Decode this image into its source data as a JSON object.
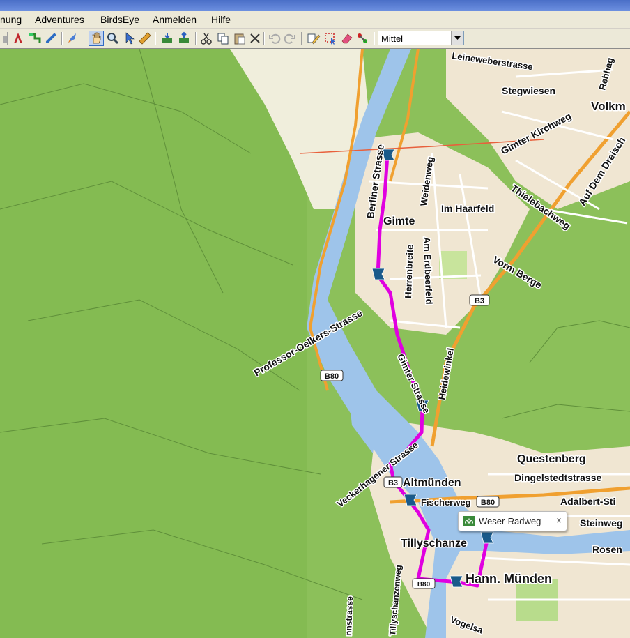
{
  "menu": {
    "items": [
      "nung",
      "Adventures",
      "BirdsEye",
      "Anmelden",
      "Hilfe"
    ]
  },
  "toolbar": {
    "zoom_value": "Mittel"
  },
  "map": {
    "places": {
      "gimte": "Gimte",
      "altmuenden": "Altmünden",
      "questenberg": "Questenberg",
      "tillyschanze": "Tillyschanze",
      "hann_muenden": "Hann. Münden",
      "volkm": "Volkm",
      "stegwiesen": "Stegwiesen",
      "im_haarfeld": "Im Haarfeld"
    },
    "streets": {
      "leineweberstrasse": "Leineweberstrasse",
      "rehhag": "Rehhag",
      "gimter_kirchweg": "Gimter Kirchweg",
      "auf_dem_dreisch": "Auf Dem Dreisch",
      "thielebachweg": "Thielebachweg",
      "weidenweg": "Weidenweg",
      "berliner_strasse": "Berliner Strasse",
      "herrenbreite": "Herrenbreite",
      "am_erdbeerfeld": "Am Erdbeerfeld",
      "vorm_berge": "Vorm Berge",
      "professor_oelkers_strasse": "Professor-Oelkers-Strasse",
      "heidewinkel": "Heidewinkel",
      "gimter_strasse": "Gimter Strasse",
      "veckerhagener_strasse": "Veckerhagener Strasse",
      "dingelstedtstrasse": "Dingelstedtstrasse",
      "adalbert_stifter": "Adalbert-Sti",
      "steinweg": "Steinweg",
      "rosen": "Rosen",
      "fischerweg": "Fischerweg",
      "tillyschanzenweg": "Tillyschanzenweg",
      "vogelsang": "Vogelsa",
      "kronstrasse": "nnstrasse"
    },
    "shields": {
      "b3": "B3",
      "b80_west": "B80",
      "b80_east": "B80",
      "b3_south": "B3",
      "b80_south": "B80"
    }
  },
  "popup": {
    "label": "Weser-Radweg",
    "close": "×"
  },
  "colors": {
    "forest": "#8cc05a",
    "river": "#9ec4ea",
    "route": "#e000e0",
    "urban": "#f0e6d2",
    "road_orange": "#f0a030",
    "flag": "#1a5a8a"
  }
}
